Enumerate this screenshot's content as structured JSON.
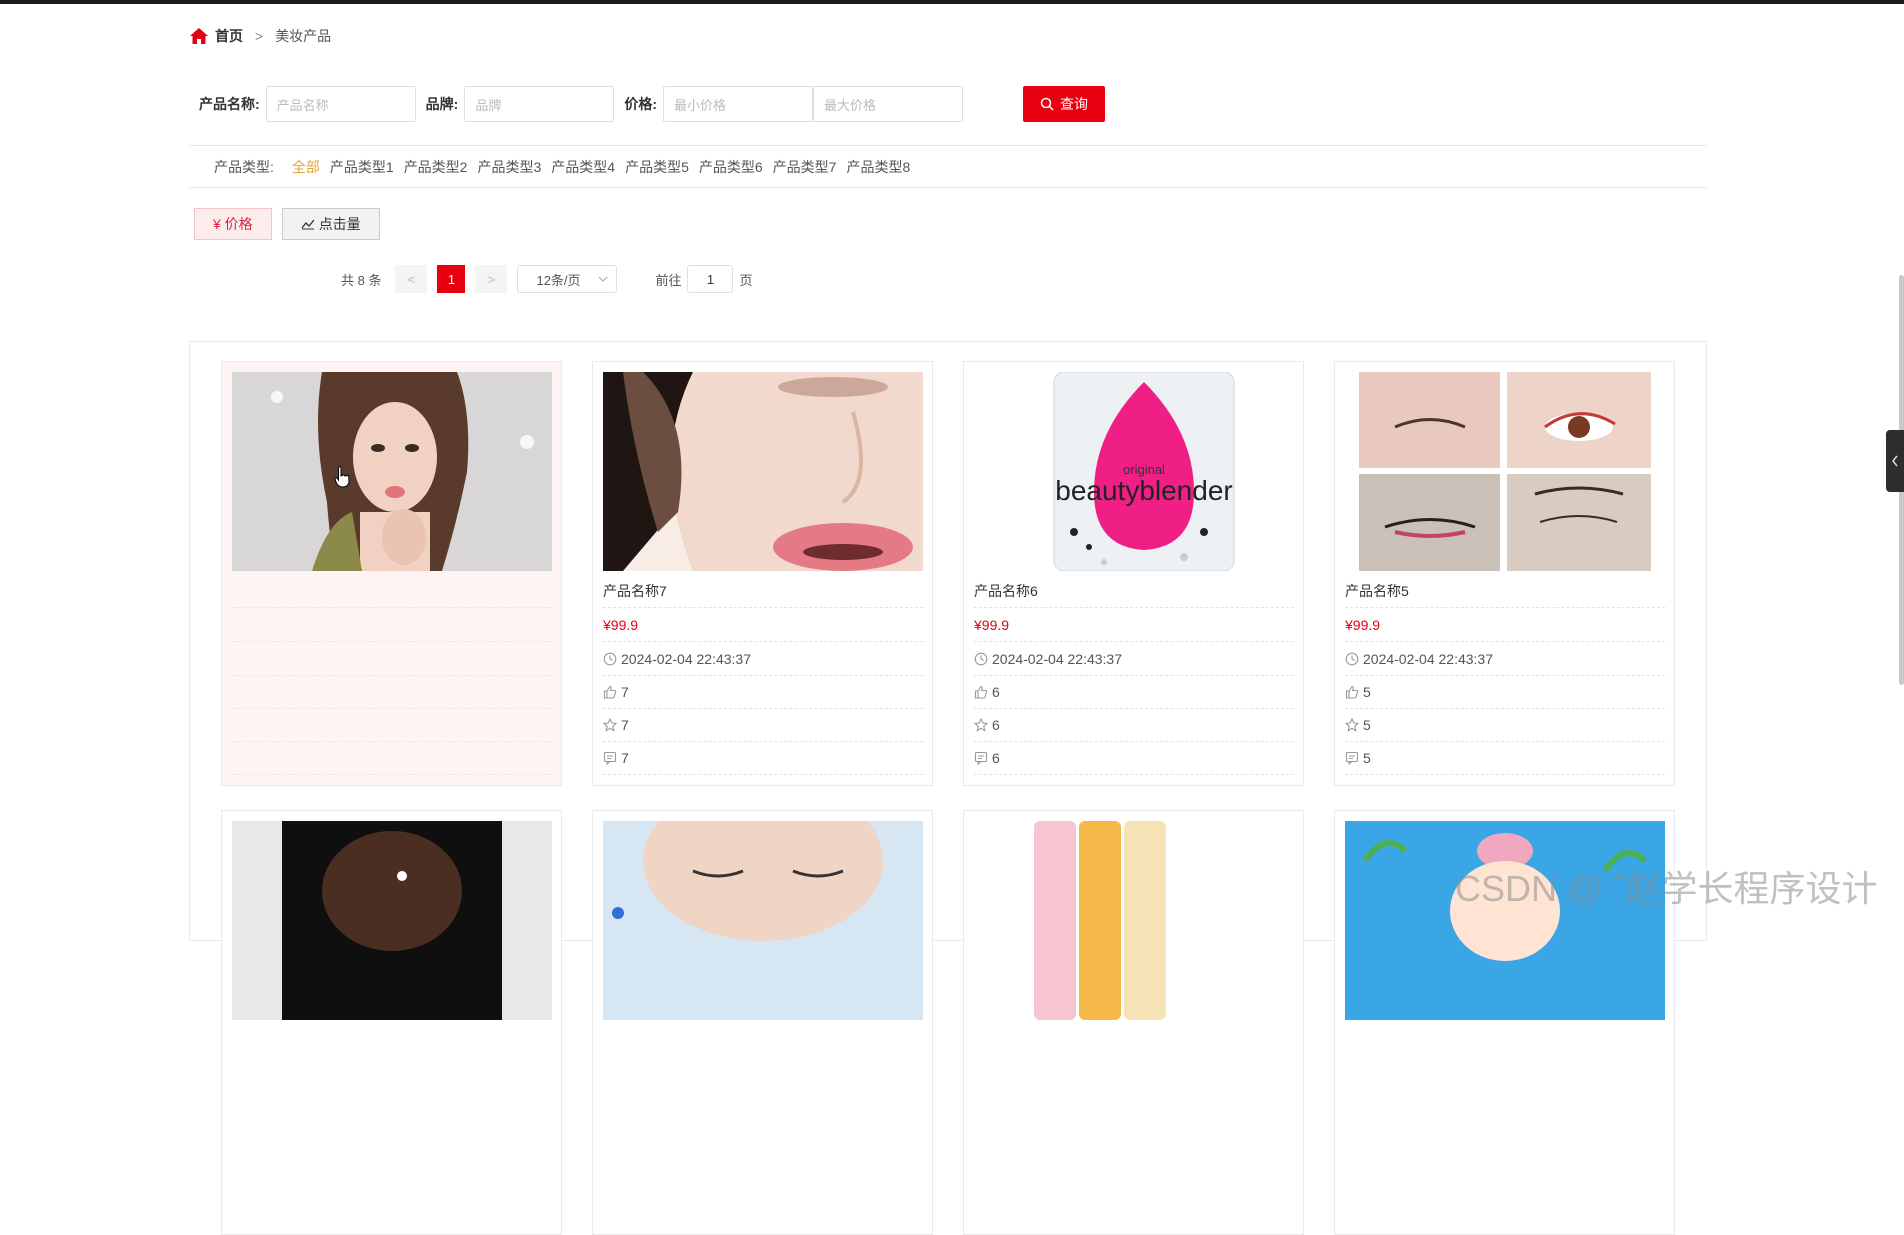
{
  "breadcrumb": {
    "home": "首页",
    "separator": ">",
    "current": "美妆产品"
  },
  "search": {
    "name_label": "产品名称:",
    "name_placeholder": "产品名称",
    "brand_label": "品牌:",
    "brand_placeholder": "品牌",
    "price_label": "价格:",
    "min_price_placeholder": "最小价格",
    "max_price_placeholder": "最大价格",
    "query_button": "查询"
  },
  "types": {
    "label": "产品类型:",
    "options": [
      "全部",
      "产品类型1",
      "产品类型2",
      "产品类型3",
      "产品类型4",
      "产品类型5",
      "产品类型6",
      "产品类型7",
      "产品类型8"
    ],
    "active": "全部"
  },
  "sort": {
    "price": "¥ 价格",
    "clicks": "点击量"
  },
  "pagination": {
    "total": "共 8 条",
    "prev": "<",
    "current": "1",
    "next": ">",
    "page_size": "12条/页",
    "goto_label": "前往",
    "goto_value": "1",
    "page_suffix": "页"
  },
  "products": [
    {
      "name": "",
      "price": "",
      "time": "",
      "likes": "",
      "favorites": "",
      "comments": "",
      "image": "woman-portrait",
      "hover": true
    },
    {
      "name": "产品名称7",
      "price": "¥99.9",
      "time": "2024-02-04 22:43:37",
      "likes": "7",
      "favorites": "7",
      "comments": "7",
      "image": "face-powder-brush"
    },
    {
      "name": "产品名称6",
      "price": "¥99.9",
      "time": "2024-02-04 22:43:37",
      "likes": "6",
      "favorites": "6",
      "comments": "6",
      "image": "beautyblender-sponge"
    },
    {
      "name": "产品名称5",
      "price": "¥99.9",
      "time": "2024-02-04 22:43:37",
      "likes": "5",
      "favorites": "5",
      "comments": "5",
      "image": "eye-makeup-grid"
    }
  ],
  "product_second_row_images": [
    "hairstyle",
    "closed-eyes-face",
    "bottles",
    "cartoon-girl"
  ],
  "beautyblender_text": [
    "original",
    "beautyblender"
  ],
  "watermark": "CSDN @ ˆ赵学长程序设计",
  "colors": {
    "accent": "#e60012",
    "active_type": "#e6a23c"
  }
}
